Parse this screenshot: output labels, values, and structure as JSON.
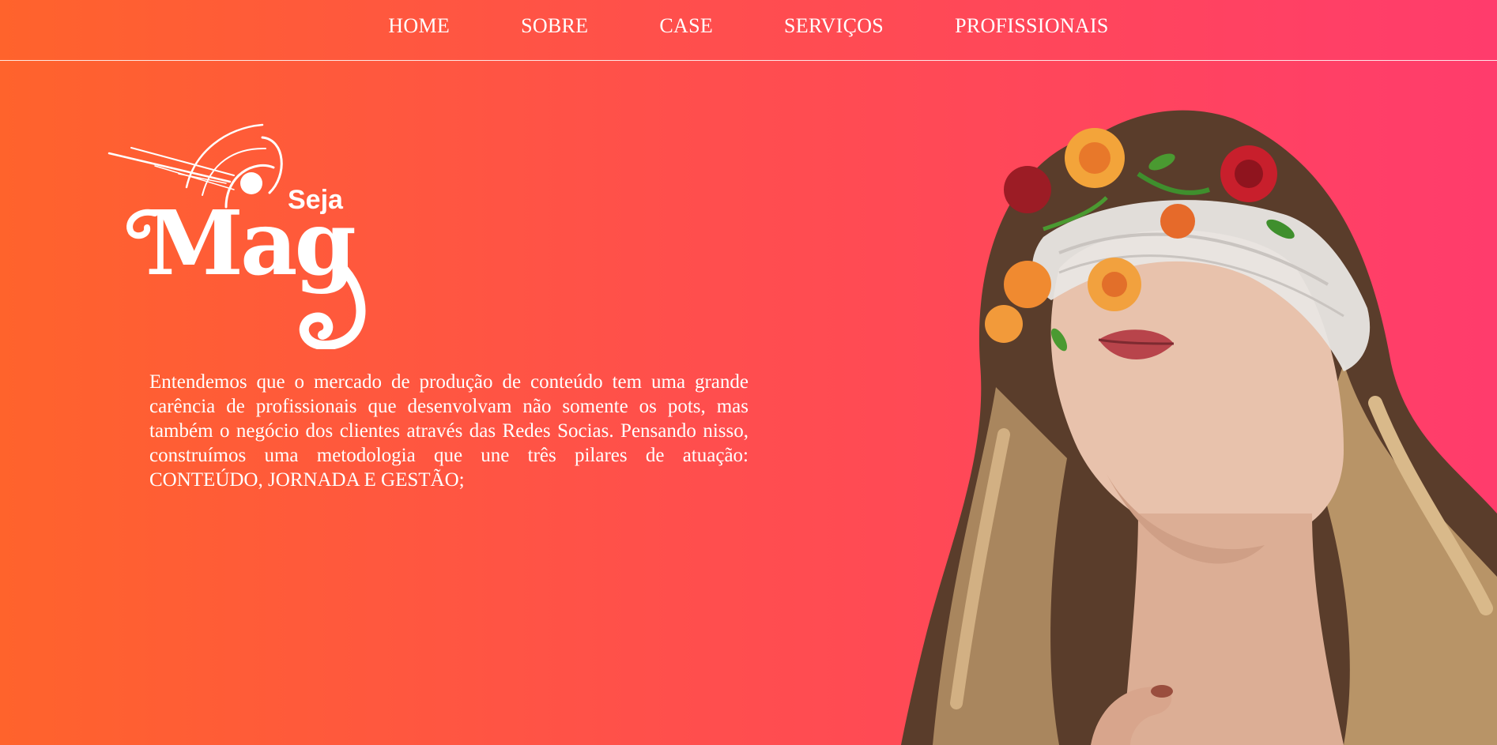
{
  "nav": {
    "items": [
      {
        "label": "HOME"
      },
      {
        "label": "SOBRE"
      },
      {
        "label": "CASE"
      },
      {
        "label": "SERVIÇOS"
      },
      {
        "label": "PROFISSIONAIS"
      }
    ]
  },
  "logo": {
    "small_text": "Seja",
    "big_text": "Mag"
  },
  "intro": {
    "text": "Entendemos que o mercado de produção de conteúdo tem uma grande carência de profissionais que desenvolvam não somente os pots, mas também o negócio dos clientes através das Redes Socias. Pensando nisso, construímos uma metodologia que une três pilares de atuação: CONTEÚDO, JORNADA E GESTÃO;"
  },
  "colors": {
    "gradient_left": "#ff632c",
    "gradient_right": "#ff3c6c",
    "text": "#ffffff"
  }
}
